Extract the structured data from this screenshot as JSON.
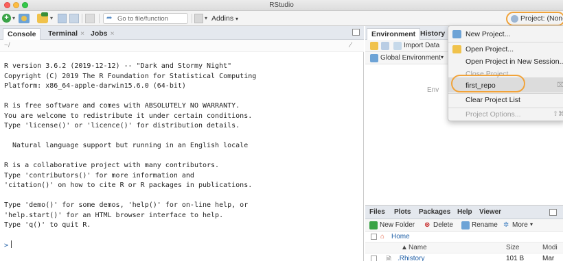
{
  "window": {
    "title": "RStudio"
  },
  "toolbar": {
    "goto_placeholder": "Go to file/function",
    "addins_label": "Addins",
    "project_label": "Project: (None)"
  },
  "console_pane": {
    "tabs": [
      {
        "label": "Console",
        "closable": false
      },
      {
        "label": "Terminal",
        "closable": true
      },
      {
        "label": "Jobs",
        "closable": true
      }
    ],
    "path": "~/",
    "lines": [
      "R version 3.6.2 (2019-12-12) -- \"Dark and Stormy Night\"",
      "Copyright (C) 2019 The R Foundation for Statistical Computing",
      "Platform: x86_64-apple-darwin15.6.0 (64-bit)",
      "",
      "R is free software and comes with ABSOLUTELY NO WARRANTY.",
      "You are welcome to redistribute it under certain conditions.",
      "Type 'license()' or 'licence()' for distribution details.",
      "",
      "  Natural language support but running in an English locale",
      "",
      "R is a collaborative project with many contributors.",
      "Type 'contributors()' for more information and",
      "'citation()' on how to cite R or R packages in publications.",
      "",
      "Type 'demo()' for some demos, 'help()' for on-line help, or",
      "'help.start()' for an HTML browser interface to help.",
      "Type 'q()' to quit R.",
      "",
      ">"
    ]
  },
  "env_pane": {
    "tabs": [
      "Environment",
      "History"
    ],
    "import_label": "Import Data",
    "scope_label": "Global Environment",
    "empty_text": "Env"
  },
  "project_menu": {
    "items": [
      {
        "label": "New Project...",
        "enabled": true,
        "icon": "new-project-icon"
      },
      {
        "label": "Open Project...",
        "enabled": true,
        "icon": "open-project-icon"
      },
      {
        "label": "Open Project in New Session...",
        "enabled": true,
        "icon": ""
      },
      {
        "label": "Close Project",
        "enabled": false,
        "icon": ""
      },
      {
        "label": "first_repo",
        "enabled": true,
        "icon": "",
        "shortcut": "⌦"
      },
      {
        "label": "Clear Project List",
        "enabled": true,
        "icon": ""
      },
      {
        "label": "Project Options...",
        "enabled": false,
        "icon": "",
        "shortcut": "⇧⌘"
      }
    ]
  },
  "files_pane": {
    "tabs": [
      "Files",
      "Plots",
      "Packages",
      "Help",
      "Viewer"
    ],
    "new_folder_label": "New Folder",
    "delete_label": "Delete",
    "rename_label": "Rename",
    "more_label": "More",
    "breadcrumb_home": "Home",
    "columns": {
      "name": "Name",
      "size": "Size",
      "modified": "Modi"
    },
    "rows": [
      {
        "name": ".Rhistory",
        "size": "101 B",
        "modified": "Mar"
      }
    ]
  },
  "colors": {
    "accent_highlight": "#f1a33a",
    "link_blue": "#1e5ea6",
    "tab_bar": "#e4e8ee"
  }
}
